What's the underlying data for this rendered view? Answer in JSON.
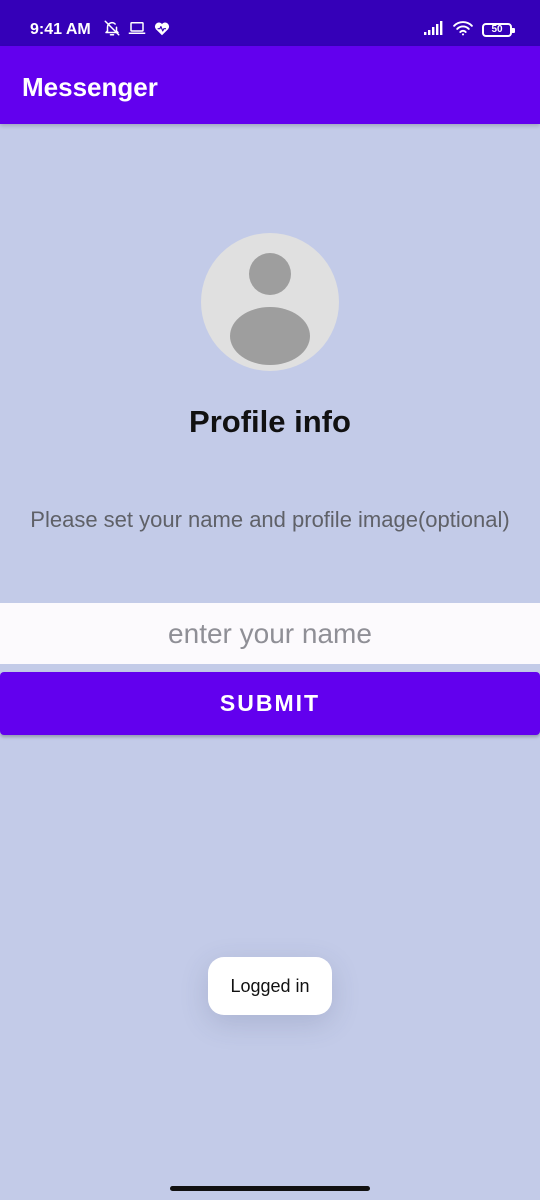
{
  "status_bar": {
    "time": "9:41 AM",
    "battery_level": "50",
    "left_icons": [
      "bell-off-icon",
      "laptop-icon",
      "heart-icon"
    ],
    "right_icons": [
      "signal-icon",
      "wifi-icon",
      "battery-icon"
    ]
  },
  "app_bar": {
    "title": "Messenger"
  },
  "profile": {
    "avatar_icon": "person-icon",
    "title": "Profile info",
    "instruction": "Please set your name and profile image(optional)"
  },
  "form": {
    "name_placeholder": "enter your name",
    "name_value": "",
    "submit_label": "SUBMIT"
  },
  "toast": {
    "message": "Logged in"
  },
  "colors": {
    "status_bar": "#3500b8",
    "primary": "#6200ee",
    "background": "#c3cbe8",
    "input_background": "#fcfafd",
    "avatar_background": "#e0e0e0",
    "avatar_foreground": "#9e9e9e"
  }
}
